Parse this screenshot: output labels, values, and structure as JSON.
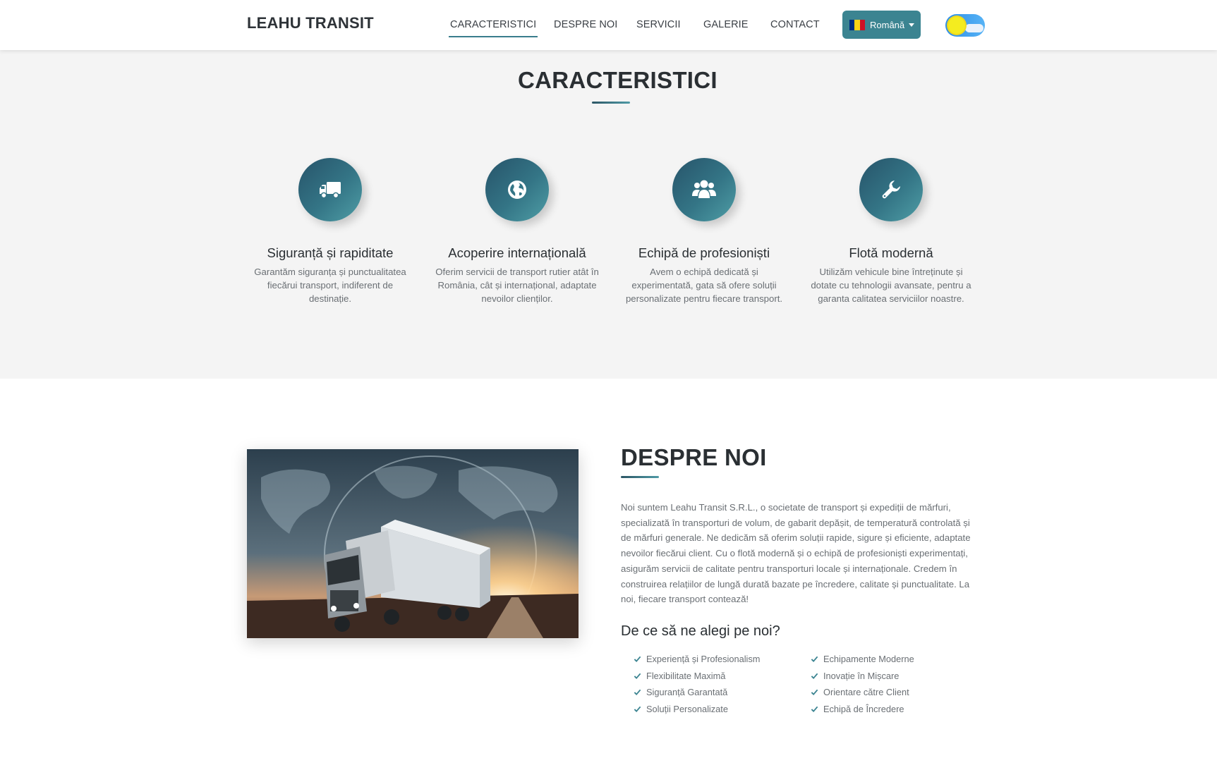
{
  "header": {
    "logo": "LEAHU TRANSIT",
    "nav": [
      "CARACTERISTICI",
      "DESPRE NOI",
      "SERVICII",
      "GALERIE",
      "CONTACT"
    ],
    "active_nav": "CARACTERISTICI",
    "language": "Română",
    "flag_colors": [
      "#002B7F",
      "#FCD116",
      "#CE1126"
    ]
  },
  "features": {
    "title": "CARACTERISTICI",
    "items": [
      {
        "icon": "truck-icon",
        "title": "Siguranță și rapiditate",
        "text": "Garantăm siguranța și punctualitatea fiecărui transport, indiferent de destinație."
      },
      {
        "icon": "globe-icon",
        "title": "Acoperire internațională",
        "text": "Oferim servicii de transport rutier atât în România, cât și internațional, adaptate nevoilor clienților."
      },
      {
        "icon": "users-icon",
        "title": "Echipă de profesioniști",
        "text": "Avem o echipă dedicată și experimentată, gata să ofere soluții personalizate pentru fiecare transport."
      },
      {
        "icon": "wrench-icon",
        "title": "Flotă modernă",
        "text": "Utilizăm vehicule bine întreținute și dotate cu tehnologii avansate, pentru a garanta calitatea serviciilor noastre."
      }
    ]
  },
  "about": {
    "title": "DESPRE NOI",
    "text": "Noi suntem Leahu Transit S.R.L., o societate de transport și expediții de mărfuri, specializată în transporturi de volum, de gabarit depășit, de temperatură controlată și de mărfuri generale. Ne dedicăm să oferim soluții rapide, sigure și eficiente, adaptate nevoilor fiecărui client. Cu o flotă modernă și o echipă de profesioniști experimentați, asigurăm servicii de calitate pentru transporturi locale și internaționale. Credem în construirea relațiilor de lungă durată bazate pe încredere, calitate și punctualitate. La noi, fiecare transport contează!",
    "why_title": "De ce să ne alegi pe noi?",
    "why_left": [
      "Experiență și Profesionalism",
      "Flexibilitate Maximă",
      "Siguranță Garantată",
      "Soluții Personalizate"
    ],
    "why_right": [
      "Echipamente Moderne",
      "Inovație în Mișcare",
      "Orientare către Client",
      "Echipă de Încredere"
    ]
  },
  "colors": {
    "accent": "#3b8491",
    "circle_dark": "#27546a",
    "circle_light": "#4f9ea6"
  }
}
